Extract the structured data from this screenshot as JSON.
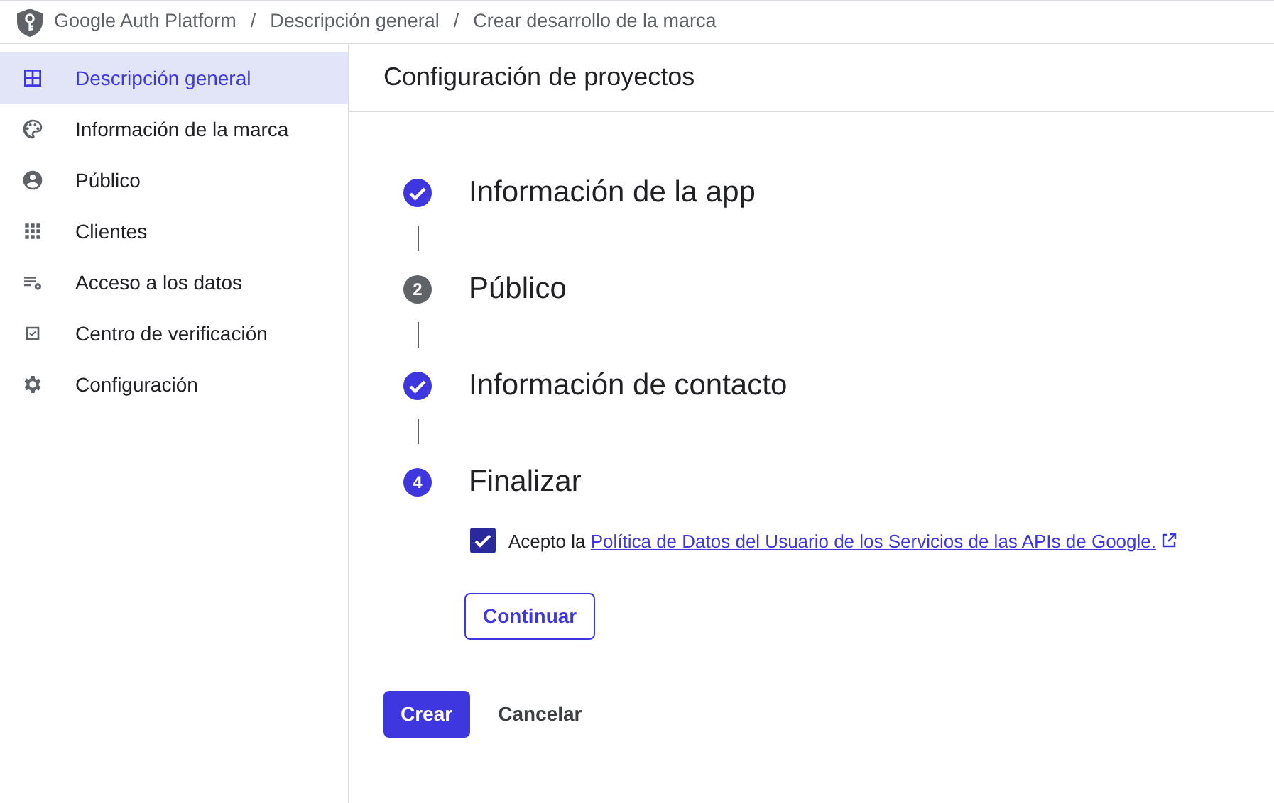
{
  "breadcrumb": [
    "Google Auth Platform",
    "Descripción general",
    "Crear desarrollo de la marca"
  ],
  "breadcrumb_separator": "/",
  "sidebar": {
    "items": [
      {
        "label": "Descripción general",
        "selected": true
      },
      {
        "label": "Información de la marca",
        "selected": false
      },
      {
        "label": "Público",
        "selected": false
      },
      {
        "label": "Clientes",
        "selected": false
      },
      {
        "label": "Acceso a los datos",
        "selected": false
      },
      {
        "label": "Centro de verificación",
        "selected": false
      },
      {
        "label": "Configuración",
        "selected": false
      }
    ]
  },
  "page_title": "Configuración de proyectos",
  "steps": [
    {
      "title": "Información de la app",
      "kind": "done",
      "selected": false
    },
    {
      "title": "Público",
      "kind": "number",
      "number": "2",
      "selected": false
    },
    {
      "title": "Información de contacto",
      "kind": "done",
      "selected": false
    },
    {
      "title": "Finalizar",
      "kind": "number",
      "number": "4",
      "selected": true
    }
  ],
  "consent": {
    "checked": true,
    "text": "Acepto la",
    "link": "Política de Datos del Usuario de los Servicios de las APIs de Google."
  },
  "continue_button": "Continuar",
  "buttons": [
    {
      "label": "Crear",
      "kind": "primary"
    },
    {
      "label": "Cancelar",
      "kind": "text"
    }
  ]
}
